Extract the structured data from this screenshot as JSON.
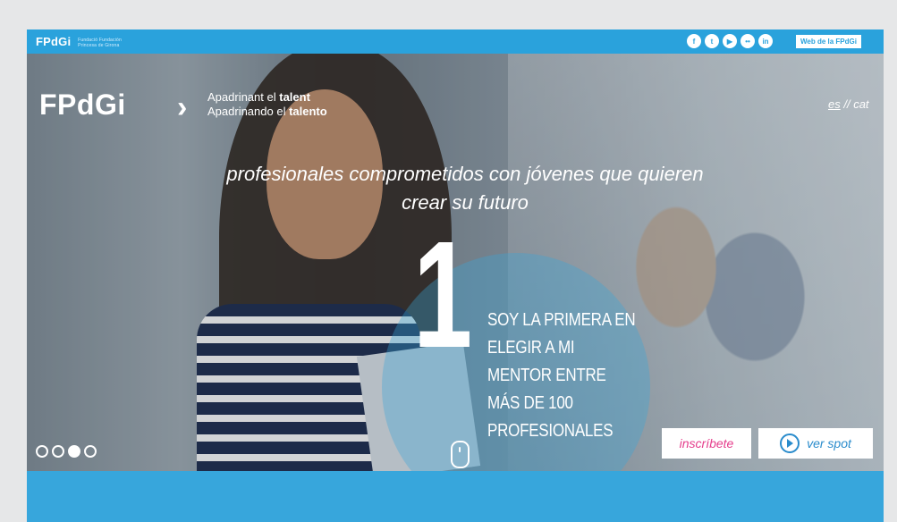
{
  "topbar": {
    "brand": "FPdGi",
    "brand_sub_line1": "Fundació Fundación",
    "brand_sub_line2": "Princesa de Girona",
    "socials": [
      {
        "icon": "facebook-icon",
        "glyph": "f"
      },
      {
        "icon": "twitter-icon",
        "glyph": "t"
      },
      {
        "icon": "youtube-icon",
        "glyph": "▶"
      },
      {
        "icon": "flickr-icon",
        "glyph": "••"
      },
      {
        "icon": "linkedin-icon",
        "glyph": "in"
      }
    ],
    "web_button": "Web de la FPdGi"
  },
  "hero": {
    "logo": "FPdGi",
    "tagline_ca_prefix": "Apadrinant el ",
    "tagline_ca_bold": "talent",
    "tagline_es_prefix": "Apadrinando el ",
    "tagline_es_bold": "talento",
    "lang_selected": "es",
    "lang_separator": " // ",
    "lang_other": "cat",
    "headline_line1": "profesionales comprometidos con jóvenes que quieren",
    "headline_line2": "crear su futuro",
    "big_number": "1",
    "claim": [
      "SOY LA PRIMERA EN",
      "ELEGIR A MI",
      "MENTOR ENTRE",
      "MÁS DE 100",
      "PROFESIONALES"
    ],
    "slides_total": 4,
    "slide_active": 3,
    "btn_inscribete": "inscríbete",
    "btn_ver_spot": "ver spot"
  },
  "colors": {
    "brand_blue": "#2aa2dc",
    "accent_pink": "#e53d8c"
  }
}
